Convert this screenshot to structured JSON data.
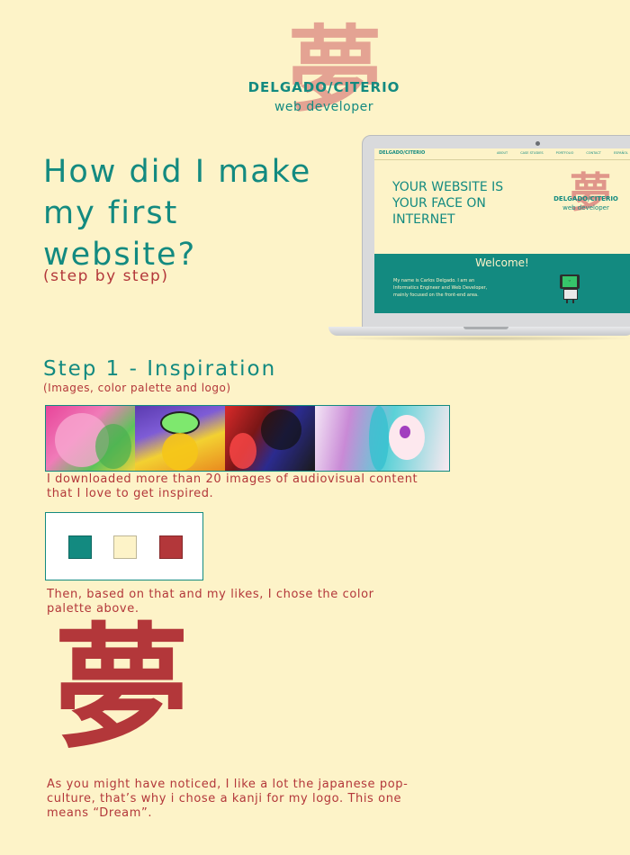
{
  "logo": {
    "kanji": "夢",
    "brand": "DELGADO/CITERIO",
    "role": "web developer"
  },
  "hero": {
    "title": "How did I make my first website?",
    "subtitle": "(step by step)"
  },
  "laptop_screen": {
    "nav_brand": "DELGADO/CITERIO",
    "nav_links": [
      "ABOUT",
      "CASE STUDIES",
      "PORTFOLIO",
      "CONTACT",
      "ESPAÑOL"
    ],
    "hero_text": "YOUR WEBSITE IS YOUR FACE ON INTERNET",
    "logo_kanji": "夢",
    "logo_brand": "DELGADO/CITERIO",
    "logo_role": "web developer",
    "welcome": "Welcome!",
    "intro": "My name is Carlos Delgado. I am an Informatics Engineer and Web Developer, mainly focused on the front-end area."
  },
  "step1": {
    "title": "Step 1 - Inspiration",
    "subtitle": "(Images, color palette and logo)",
    "images_caption": "I downloaded more than 20 images of audiovisual content that I love to get inspired.",
    "palette_caption": "Then, based on that and my likes, I chose the color palette above.",
    "logo_caption": "As you might have noticed, I like a lot the japanese pop-culture, that’s why i chose a kanji for my logo. This one means “Dream”."
  },
  "palette": {
    "colors": [
      "#138a80",
      "#fdf3c8",
      "#b3373a"
    ]
  },
  "kanji_logo": "夢"
}
